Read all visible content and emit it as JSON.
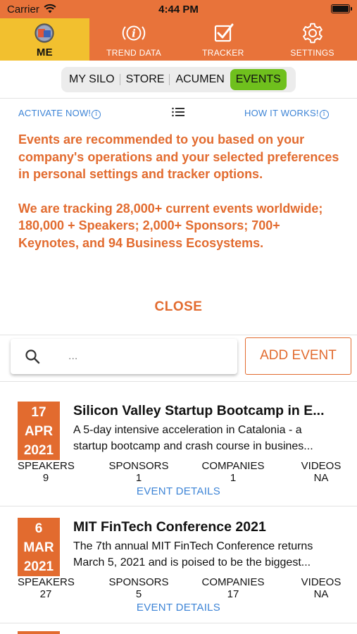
{
  "status_bar": {
    "carrier": "Carrier",
    "time": "4:44 PM"
  },
  "tabs": [
    {
      "label": "ME",
      "icon": "avatar-icon",
      "active": true
    },
    {
      "label": "TREND DATA",
      "icon": "info-broadcast-icon",
      "active": false
    },
    {
      "label": "TRACKER",
      "icon": "checkbox-icon",
      "active": false
    },
    {
      "label": "SETTINGS",
      "icon": "gear-icon",
      "active": false
    }
  ],
  "segments": [
    {
      "label": "MY SILO",
      "selected": false
    },
    {
      "label": "STORE",
      "selected": false
    },
    {
      "label": "ACUMEN",
      "selected": false
    },
    {
      "label": "EVENTS",
      "selected": true
    }
  ],
  "links": {
    "activate": "ACTIVATE NOW!",
    "how_it_works": "HOW IT WORKS!",
    "info_glyph": "i"
  },
  "info": {
    "paragraph1": "Events are recommended to you based on your company's operations and your selected preferences in personal settings and tracker options.",
    "paragraph2": "We are tracking 28,000+ current events worldwide; 180,000 + Speakers; 2,000+ Sponsors; 700+ Keynotes, and 94 Business Ecosystems.",
    "close_label": "CLOSE"
  },
  "search": {
    "placeholder": "..."
  },
  "add_event_label": "ADD EVENT",
  "stat_labels": {
    "speakers": "SPEAKERS",
    "sponsors": "SPONSORS",
    "companies": "COMPANIES",
    "videos": "VIDEOS"
  },
  "details_label": "EVENT DETAILS",
  "events": [
    {
      "day": "17",
      "month": "APR",
      "year": "2021",
      "title": "Silicon Valley Startup Bootcamp in E...",
      "desc_line1": "A 5-day intensive acceleration in Catalonia - a",
      "desc_line2": "startup bootcamp and crash course in busines...",
      "speakers": "9",
      "sponsors": "1",
      "companies": "1",
      "videos": "NA"
    },
    {
      "day": "6",
      "month": "MAR",
      "year": "2021",
      "title": "MIT FinTech Conference 2021",
      "desc_line1": "The 7th annual MIT FinTech Conference returns",
      "desc_line2": "March 5, 2021 and is poised to be the biggest...",
      "speakers": "27",
      "sponsors": "5",
      "companies": "17",
      "videos": "NA"
    }
  ],
  "colors": {
    "accent": "#e8733a",
    "active_tab": "#f2c02f",
    "selected_segment": "#6fc01d",
    "link": "#3d84d6",
    "text_accent": "#e26b2f"
  }
}
